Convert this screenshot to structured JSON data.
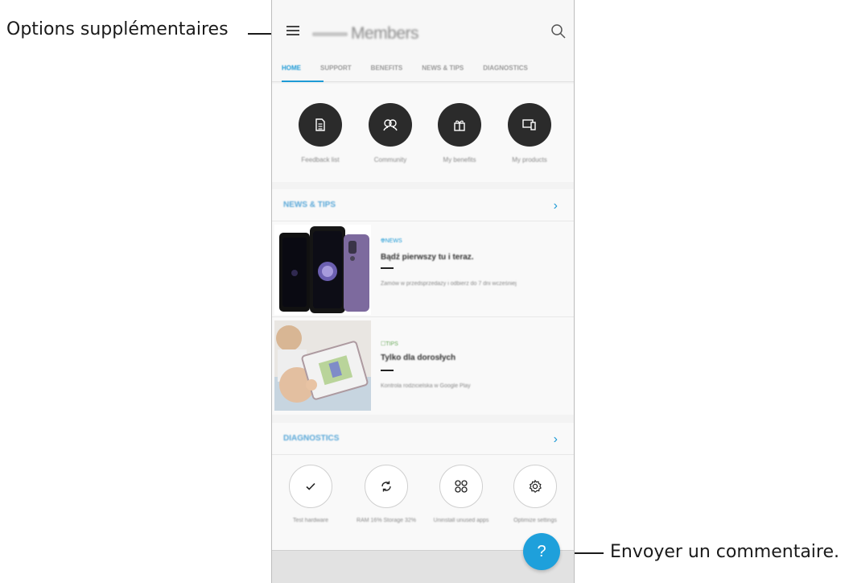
{
  "callouts": {
    "menu": "Options supplémentaires",
    "feedback": "Envoyer un commentaire."
  },
  "app": {
    "brand_prefix": "SAMSUNG",
    "title": "Members",
    "search_icon": "search-icon",
    "menu_icon": "hamburger-menu-icon"
  },
  "tabs": [
    {
      "label": "HOME",
      "active": true
    },
    {
      "label": "SUPPORT",
      "active": false
    },
    {
      "label": "BENEFITS",
      "active": false
    },
    {
      "label": "NEWS & TIPS",
      "active": false
    },
    {
      "label": "DIAGNOSTICS",
      "active": false
    }
  ],
  "shortcuts": [
    {
      "label": "Feedback list",
      "icon": "document-icon"
    },
    {
      "label": "Community",
      "icon": "people-icon"
    },
    {
      "label": "My benefits",
      "icon": "gift-icon"
    },
    {
      "label": "My products",
      "icon": "devices-icon"
    }
  ],
  "news": {
    "section_title": "NEWS & TIPS",
    "items": [
      {
        "tag": "NEWS",
        "tag_icon": "globe-icon",
        "title": "Bądź pierwszy tu i teraz.",
        "description": "Zamów w przedsprzedaży i odbierz do 7 dni wcześniej"
      },
      {
        "tag": "TIPS",
        "tag_icon": "bookmark-icon",
        "title": "Tylko dla dorosłych",
        "description": "Kontrola rodzicielska w Google Play"
      }
    ]
  },
  "diagnostics": {
    "section_title": "DIAGNOSTICS",
    "items": [
      {
        "label": "Test hardware",
        "icon": "check-icon"
      },
      {
        "label": "RAM 16% Storage 32%",
        "icon": "refresh-icon"
      },
      {
        "label": "Uninstall unused apps",
        "icon": "apps-grid-icon"
      },
      {
        "label": "Optimize settings",
        "icon": "gear-icon"
      }
    ]
  },
  "fab": {
    "label": "?",
    "icon": "help-icon"
  },
  "colors": {
    "accent": "#1e9ad6",
    "shortcut_circle": "#2b2b2b",
    "background": "#f3f3f3"
  }
}
